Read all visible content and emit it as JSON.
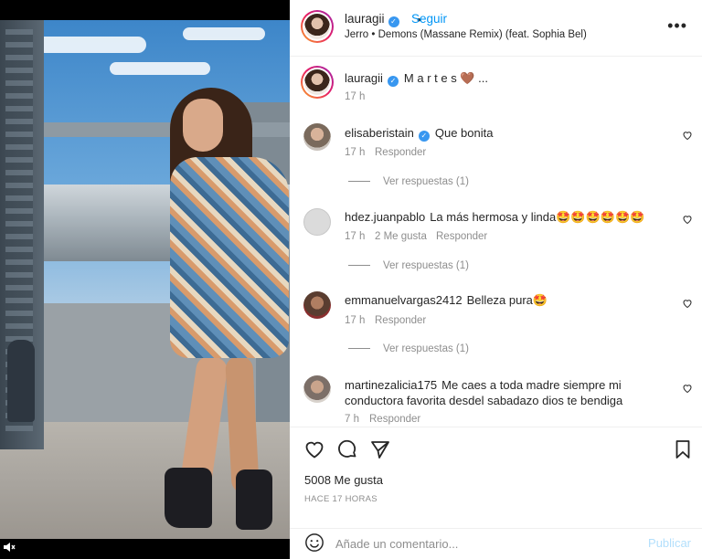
{
  "post": {
    "author": "lauragii",
    "follow_label": "Seguir",
    "separator": "•",
    "music": "Jerro • Demons (Massane Remix) (feat. Sophia Bel)",
    "more_icon": "•••",
    "caption_text": "M a r t e s 🤎 ...",
    "caption_time": "17 h"
  },
  "comments": [
    {
      "user": "elisaberistain",
      "verified": true,
      "text": "Que bonita",
      "time": "17 h",
      "likes": "",
      "reply_label": "Responder",
      "view_replies": "Ver respuestas (1)"
    },
    {
      "user": "hdez.juanpablo",
      "verified": false,
      "text": "La más hermosa y linda🤩🤩🤩🤩🤩🤩",
      "time": "17 h",
      "likes": "2 Me gusta",
      "reply_label": "Responder",
      "view_replies": "Ver respuestas (1)"
    },
    {
      "user": "emmanuelvargas2412",
      "verified": false,
      "text": "Belleza pura🤩",
      "time": "17 h",
      "likes": "",
      "reply_label": "Responder",
      "view_replies": "Ver respuestas (1)"
    },
    {
      "user": "martinezalicia175",
      "verified": false,
      "text": "Me caes a toda madre siempre mi",
      "text2": "conductora favorita desdel sabadazo dios te bendiga",
      "time": "7 h",
      "likes": "",
      "reply_label": "Responder"
    }
  ],
  "stats": {
    "likes": "5008 Me gusta",
    "ago": "HACE 17 HORAS"
  },
  "composer": {
    "placeholder": "Añade un comentario...",
    "publish_label": "Publicar"
  },
  "icons": {
    "mute": "muted-speaker-icon",
    "like": "heart-icon",
    "comment": "comment-icon",
    "share": "paper-plane-icon",
    "save": "bookmark-icon",
    "emoji": "smiley-icon",
    "verified": "verified-badge-icon"
  }
}
